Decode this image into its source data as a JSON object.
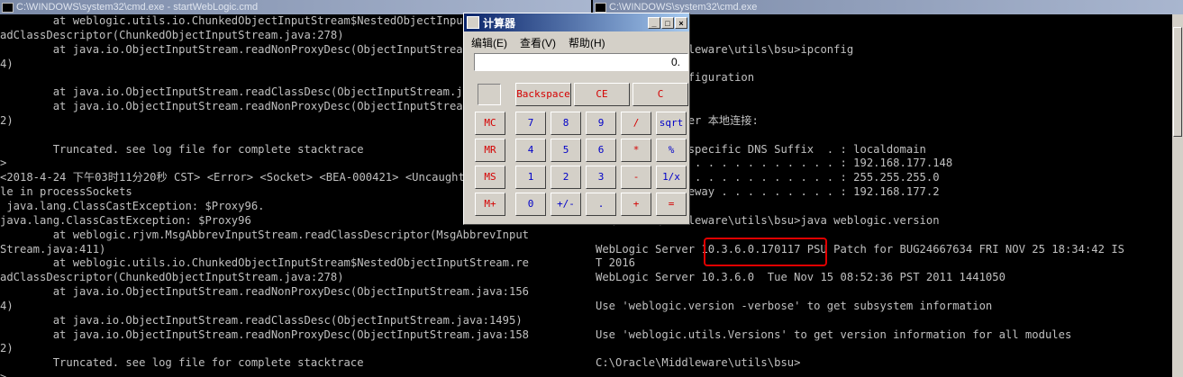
{
  "left_window": {
    "title": "C:\\WINDOWS\\system32\\cmd.exe - startWebLogic.cmd",
    "lines": [
      "        at weblogic.utils.io.ChunkedObjectInputStream$NestedObjectInputStream.re",
      "adClassDescriptor(ChunkedObjectInputStream.java:278)",
      "        at java.io.ObjectInputStream.readNonProxyDesc(ObjectInputStream.java:156",
      "4)",
      "",
      "        at java.io.ObjectInputStream.readClassDesc(ObjectInputStream.java:1495)",
      "        at java.io.ObjectInputStream.readNonProxyDesc(ObjectInputStream.java:158",
      "2)",
      "",
      "        Truncated. see log file for complete stacktrace",
      ">",
      "<2018-4-24 下午03时11分20秒 CST> <Error> <Socket> <BEA-000421> <Uncaught Throwab",
      "le in processSockets",
      " java.lang.ClassCastException: $Proxy96.",
      "java.lang.ClassCastException: $Proxy96",
      "        at weblogic.rjvm.MsgAbbrevInputStream.readClassDescriptor(MsgAbbrevInput",
      "Stream.java:411)",
      "        at weblogic.utils.io.ChunkedObjectInputStream$NestedObjectInputStream.re",
      "adClassDescriptor(ChunkedObjectInputStream.java:278)",
      "        at java.io.ObjectInputStream.readNonProxyDesc(ObjectInputStream.java:156",
      "4)",
      "        at java.io.ObjectInputStream.readClassDesc(ObjectInputStream.java:1495)",
      "        at java.io.ObjectInputStream.readNonProxyDesc(ObjectInputStream.java:158",
      "2)",
      "        Truncated. see log file for complete stacktrace",
      ">"
    ]
  },
  "right_window": {
    "title": "C:\\WINDOWS\\system32\\cmd.exe",
    "lines": [
      "",
      "",
      "C:\\Oracle\\Middleware\\utils\\bsu>ipconfig",
      "",
      "Windows IP Configuration",
      "",
      "",
      "Ethernet adapter 本地连接:",
      "",
      "   Connection-specific DNS Suffix  . : localdomain",
      "   IP Address. . . . . . . . . . . . : 192.168.177.148",
      "   Subnet Mask . . . . . . . . . . . : 255.255.255.0",
      "   Default Gateway . . . . . . . . . : 192.168.177.2",
      "",
      "C:\\Oracle\\Middleware\\utils\\bsu>java weblogic.version",
      "",
      "WebLogic Server 10.3.6.0.170117 PSU Patch for BUG24667634 FRI NOV 25 18:34:42 IS",
      "T 2016",
      "WebLogic Server 10.3.6.0  Tue Nov 15 08:52:36 PST 2011 1441050",
      "",
      "Use 'weblogic.version -verbose' to get subsystem information",
      "",
      "Use 'weblogic.utils.Versions' to get version information for all modules",
      "",
      "C:\\Oracle\\Middleware\\utils\\bsu>"
    ]
  },
  "calculator": {
    "title": "计算器",
    "menu": [
      "编辑(E)",
      "查看(V)",
      "帮助(H)"
    ],
    "display": "0.",
    "buttons": {
      "backspace": "Backspace",
      "ce": "CE",
      "c": "C",
      "mc": "MC",
      "mr": "MR",
      "ms": "MS",
      "mplus": "M+",
      "n7": "7",
      "n8": "8",
      "n9": "9",
      "div": "/",
      "sqrt": "sqrt",
      "n4": "4",
      "n5": "5",
      "n6": "6",
      "mul": "*",
      "pct": "%",
      "n1": "1",
      "n2": "2",
      "n3": "3",
      "sub": "-",
      "inv": "1/x",
      "n0": "0",
      "sign": "+/-",
      "dot": ".",
      "add": "+",
      "eq": "="
    }
  },
  "colors": {
    "console_text": "#c0c0c0",
    "highlight": "#e00000",
    "calc_red": "#d40000",
    "calc_blue": "#0000c8"
  }
}
